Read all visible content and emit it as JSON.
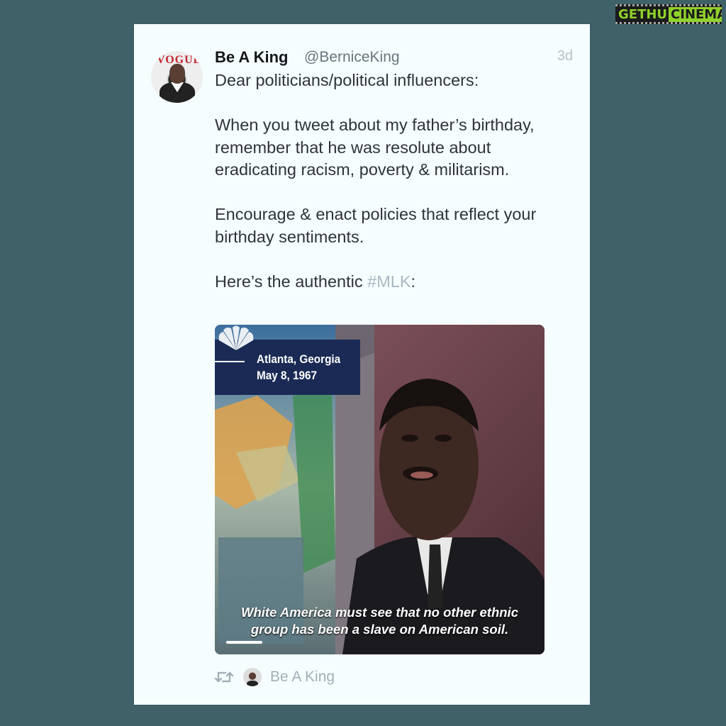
{
  "watermark": {
    "left_text": "GETHU",
    "right_text": "CINEMA"
  },
  "tweet": {
    "display_name": "Be A King",
    "handle": "@BerniceKing",
    "time_ago": "3d",
    "avatar_text": "VOGUE",
    "paragraphs": [
      "Dear politicians/political influencers:",
      "When you tweet about my father’s birthday, remember that he was resolute about eradicating racism, poverty & militarism.",
      "Encourage & enact policies that reflect your birthday sentiments."
    ],
    "closing_prefix": "Here’s the authentic ",
    "hashtag": "#MLK",
    "closing_suffix": ":"
  },
  "media": {
    "location": "Atlanta, Georgia",
    "date": "May 8, 1967",
    "caption_line1": "White America must see that no other ethnic",
    "caption_line2": "group has been a slave on American soil.",
    "progress": 0.11
  },
  "footer": {
    "retweet_icon": "retweet-icon",
    "retweeted_by": "Be A King"
  },
  "colors": {
    "background": "#3f6168",
    "card": "#f6fdff",
    "hashtag": "#a9b8c2",
    "location_box": "#1a2a55"
  }
}
